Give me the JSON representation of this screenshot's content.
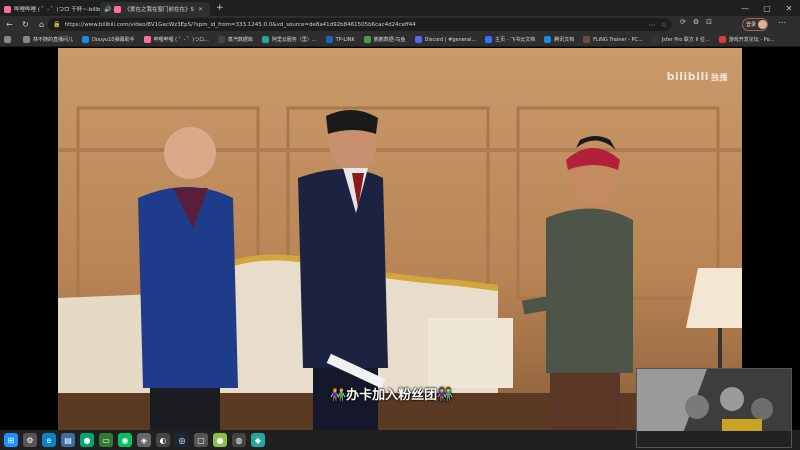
{
  "tabs": [
    {
      "title": "哔哩哔哩 ( ゜- ゜)つロ 干杯~-bilibili",
      "active": false,
      "favicon_color": "#fb7299",
      "audio": false
    },
    {
      "title": "《爱在之我在窗门前在在》5",
      "active": true,
      "favicon_color": "#fb7299",
      "audio": true
    }
  ],
  "window_controls": {
    "minimize": "—",
    "maximize": "▢",
    "close": "✕"
  },
  "nav": {
    "back": "←",
    "reload": "↻",
    "home": "⌂"
  },
  "address": {
    "url": "https://www.bilibili.com/video/BV1GecWz3EpS/?spm_id_from=333.1245.0.0&vd_source=de8a41d92b8461505b6cac4d24ceff44",
    "lock_icon": "lock-icon"
  },
  "omnibox_icons": [
    "⋯",
    "☆"
  ],
  "toolbar_icons": [
    "⟳",
    "⚙",
    "⊡"
  ],
  "profile": {
    "label": "登录"
  },
  "bookmarks": [
    {
      "label": "",
      "color": "#888"
    },
    {
      "label": "林不随的直播间儿",
      "color": "#888"
    },
    {
      "label": "Douyu10弹幕助手",
      "color": "#1e88e5"
    },
    {
      "label": "哔哩哔哩 ( ゜- ゜)つロ...",
      "color": "#fb7299"
    },
    {
      "label": "蒸汽数据库",
      "color": "#444"
    },
    {
      "label": "阿里云服务（里）...",
      "color": "#26a69a"
    },
    {
      "label": "TP-LINK",
      "color": "#1565c0"
    },
    {
      "label": "鹏鹏数据-鸟鱼",
      "color": "#43a047"
    },
    {
      "label": "Discord | #general...",
      "color": "#5865f2"
    },
    {
      "label": "主页 - 飞书云文档",
      "color": "#3370ff"
    },
    {
      "label": "腾讯文档",
      "color": "#1e88e5"
    },
    {
      "label": "FLiNG Trainer - PC...",
      "color": "#6d4c41"
    },
    {
      "label": "Jsfer Pro 联方 II 位...",
      "color": "#333"
    },
    {
      "label": "游戏开发论坛 - Po...",
      "color": "#e53935"
    }
  ],
  "video": {
    "watermark": "bilibili",
    "watermark_badge": "独播",
    "subtitle": "👫办卡加入粉丝团👫"
  },
  "taskbar": [
    {
      "icon": "windows-icon",
      "glyph": "⊞",
      "color": "#1e90ff"
    },
    {
      "icon": "settings-icon",
      "glyph": "⚙",
      "color": "#555"
    },
    {
      "icon": "edge-icon",
      "glyph": "e",
      "color": "#0a84c6"
    },
    {
      "icon": "notes-icon",
      "glyph": "▤",
      "color": "#3b6ea5"
    },
    {
      "icon": "app-icon",
      "glyph": "●",
      "color": "#00a86b"
    },
    {
      "icon": "chat-icon",
      "glyph": "▭",
      "color": "#2e7d32"
    },
    {
      "icon": "wechat-icon",
      "glyph": "◉",
      "color": "#07c160"
    },
    {
      "icon": "app2-icon",
      "glyph": "◈",
      "color": "#666"
    },
    {
      "icon": "qq-icon",
      "glyph": "◐",
      "color": "#444"
    },
    {
      "icon": "steam-icon",
      "glyph": "◎",
      "color": "#1b2838"
    },
    {
      "icon": "app3-icon",
      "glyph": "▢",
      "color": "#555"
    },
    {
      "icon": "app4-icon",
      "glyph": "●",
      "color": "#8bc34a"
    },
    {
      "icon": "app5-icon",
      "glyph": "◍",
      "color": "#444"
    },
    {
      "icon": "app6-icon",
      "glyph": "◆",
      "color": "#26a69a"
    }
  ],
  "colors": {
    "accent": "#fb7299"
  }
}
